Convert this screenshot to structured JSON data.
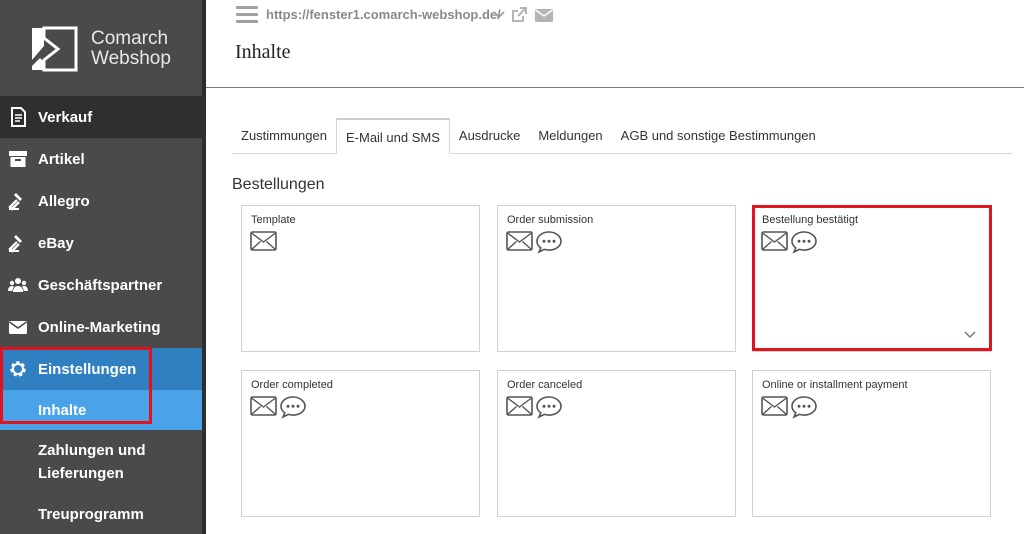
{
  "app": {
    "logo_line1": "Comarch",
    "logo_line2": "Webshop"
  },
  "topbar": {
    "url": "https://fenster1.comarch-webshop.de/",
    "page_title": "Inhalte"
  },
  "sidebar": {
    "items": [
      {
        "label": "Verkauf",
        "icon": "document-icon"
      },
      {
        "label": "Artikel",
        "icon": "box-icon"
      },
      {
        "label": "Allegro",
        "icon": "gavel-icon"
      },
      {
        "label": "eBay",
        "icon": "gavel-icon"
      },
      {
        "label": "Geschäftspartner",
        "icon": "users-icon"
      },
      {
        "label": "Online-Marketing",
        "icon": "envelope-icon"
      },
      {
        "label": "Einstellungen",
        "icon": "gear-icon"
      }
    ],
    "subitems": [
      {
        "label": "Inhalte"
      },
      {
        "label_line1": "Zahlungen und",
        "label_line2": "Lieferungen"
      },
      {
        "label": "Treuprogramm"
      }
    ]
  },
  "tabs": [
    {
      "label": "Zustimmungen"
    },
    {
      "label": "E-Mail und SMS"
    },
    {
      "label": "Ausdrucke"
    },
    {
      "label": "Meldungen"
    },
    {
      "label": "AGB und sonstige Bestimmungen"
    }
  ],
  "section": {
    "title": "Bestellungen"
  },
  "cards": [
    {
      "title": "Template"
    },
    {
      "title": "Order submission"
    },
    {
      "title": "Bestellung bestätigt"
    },
    {
      "title": "Order completed"
    },
    {
      "title": "Order canceled"
    },
    {
      "title": "Online or installment payment"
    }
  ],
  "colors": {
    "sidebar_bg": "#4a4a4a",
    "active_blue": "#2f7fc1",
    "subitem_blue": "#4aa3e8",
    "highlight_red": "#e0141e"
  }
}
